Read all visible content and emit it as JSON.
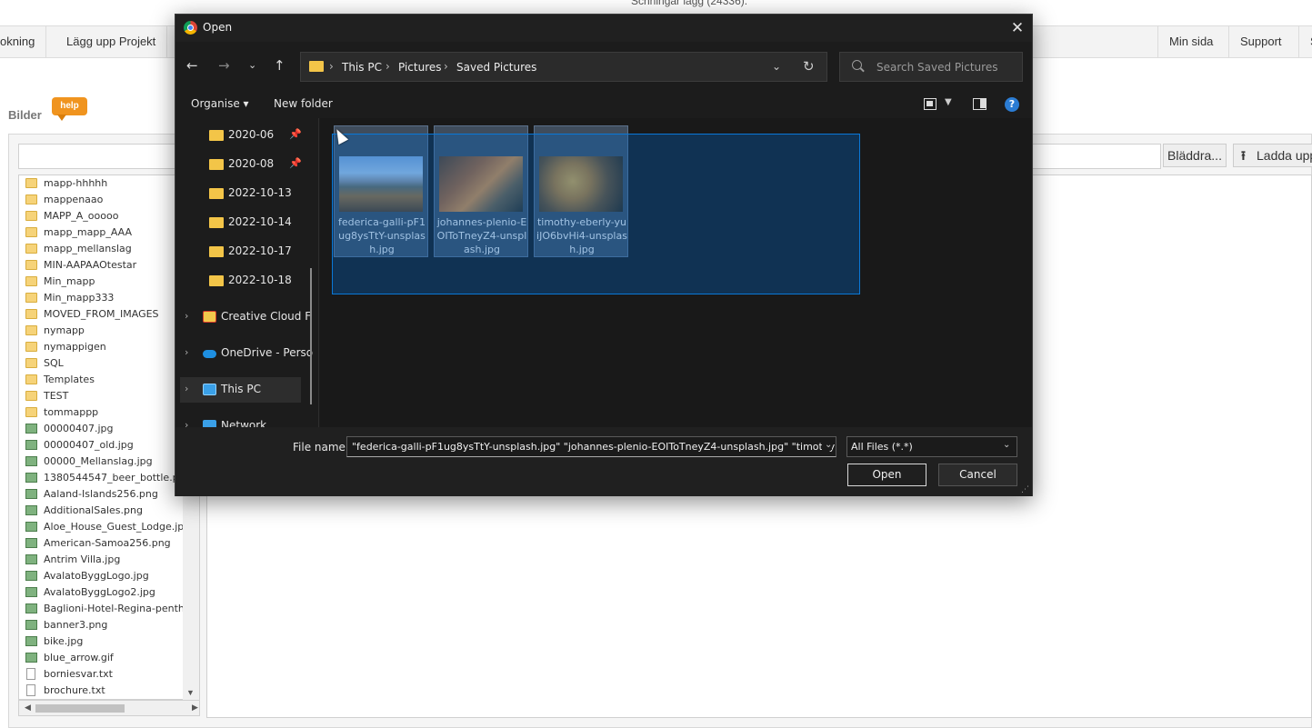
{
  "background": {
    "partial_title": "Schningar lägg (24336).",
    "nav_left": [
      "okning",
      "Lägg upp Projekt"
    ],
    "nav_right": [
      "Min sida",
      "Support",
      "S"
    ],
    "section_title": "Bilder",
    "help_badge": "help",
    "browse_label": "Bläddra...",
    "upload_label": "Ladda upp",
    "files": [
      {
        "name": "mapp-hhhhh",
        "type": "folder"
      },
      {
        "name": "mappenaao",
        "type": "folder"
      },
      {
        "name": "MAPP_A_ooooo",
        "type": "folder"
      },
      {
        "name": "mapp_mapp_AAA",
        "type": "folder"
      },
      {
        "name": "mapp_mellanslag",
        "type": "folder"
      },
      {
        "name": "MIN-AAPAAOtestar",
        "type": "folder"
      },
      {
        "name": "Min_mapp",
        "type": "folder"
      },
      {
        "name": "Min_mapp333",
        "type": "folder"
      },
      {
        "name": "MOVED_FROM_IMAGES",
        "type": "folder"
      },
      {
        "name": "nymapp",
        "type": "folder"
      },
      {
        "name": "nymappigen",
        "type": "folder"
      },
      {
        "name": "SQL",
        "type": "folder"
      },
      {
        "name": "Templates",
        "type": "folder"
      },
      {
        "name": "TEST",
        "type": "folder"
      },
      {
        "name": "tommappp",
        "type": "folder"
      },
      {
        "name": "00000407.jpg",
        "type": "image"
      },
      {
        "name": "00000407_old.jpg",
        "type": "image"
      },
      {
        "name": "00000_Mellanslag.jpg",
        "type": "image"
      },
      {
        "name": "1380544547_beer_bottle.p",
        "type": "image"
      },
      {
        "name": "Aaland-Islands256.png",
        "type": "image"
      },
      {
        "name": "AdditionalSales.png",
        "type": "image"
      },
      {
        "name": "Aloe_House_Guest_Lodge.jpg",
        "type": "image"
      },
      {
        "name": "American-Samoa256.png",
        "type": "image"
      },
      {
        "name": "Antrim Villa.jpg",
        "type": "image"
      },
      {
        "name": "AvalatoByggLogo.jpg",
        "type": "image"
      },
      {
        "name": "AvalatoByggLogo2.jpg",
        "type": "image"
      },
      {
        "name": "Baglioni-Hotel-Regina-penth",
        "type": "image"
      },
      {
        "name": "banner3.png",
        "type": "image"
      },
      {
        "name": "bike.jpg",
        "type": "image"
      },
      {
        "name": "blue_arrow.gif",
        "type": "image"
      },
      {
        "name": "borniesvar.txt",
        "type": "text"
      },
      {
        "name": "brochure.txt",
        "type": "text"
      }
    ]
  },
  "dialog": {
    "title": "Open",
    "breadcrumb": [
      "This PC",
      "Pictures",
      "Saved Pictures"
    ],
    "search_placeholder": "Search Saved Pictures",
    "organise_label": "Organise ▾",
    "new_folder_label": "New folder",
    "help_symbol": "?",
    "quick_access": [
      {
        "label": "2020-06",
        "pinned": true
      },
      {
        "label": "2020-08",
        "pinned": true
      },
      {
        "label": "2022-10-13",
        "pinned": false
      },
      {
        "label": "2022-10-14",
        "pinned": false
      },
      {
        "label": "2022-10-17",
        "pinned": false
      },
      {
        "label": "2022-10-18",
        "pinned": false
      }
    ],
    "locations": [
      "Creative Cloud F",
      "OneDrive - Perso",
      "This PC",
      "Network"
    ],
    "files": [
      {
        "name": "federica-galli-pF1ug8ysTtY-unsplash.jpg"
      },
      {
        "name": "johannes-plenio-EOIToTneyZ4-unsplash.jpg"
      },
      {
        "name": "timothy-eberly-yuiJO6bvHi4-unsplash.jpg"
      }
    ],
    "file_name_label": "File name:",
    "file_name_value": "\"federica-galli-pF1ug8ysTtY-unsplash.jpg\" \"johannes-plenio-EOIToTneyZ4-unsplash.jpg\" \"timothy",
    "file_type_value": "All Files (*.*)",
    "open_label": "Open",
    "cancel_label": "Cancel",
    "colors": {
      "accent": "#0a78d7",
      "folder": "#f3c548",
      "background": "#1c1c1c"
    }
  }
}
